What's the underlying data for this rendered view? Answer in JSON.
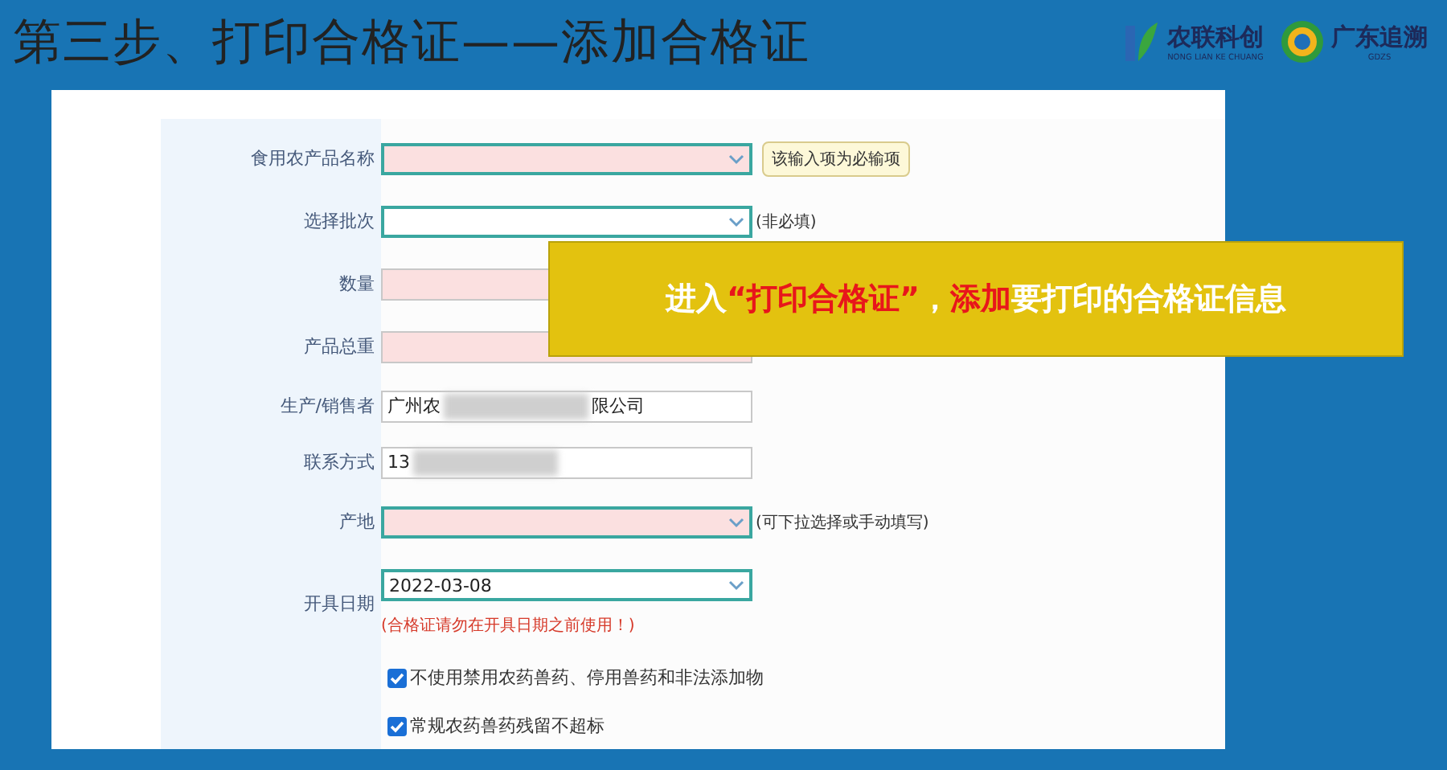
{
  "slide_title": "第三步、打印合格证——添加合格证",
  "logos": [
    {
      "name": "农联科创",
      "subtitle": "NONG LIAN KE CHUANG"
    },
    {
      "name": "广东追溯",
      "subtitle": "GDZS"
    }
  ],
  "form": {
    "rows": [
      {
        "label": "食用农产品名称",
        "kind": "select",
        "invalid": true,
        "tooltip": "该输入项为必输项"
      },
      {
        "label": "选择批次",
        "kind": "select",
        "invalid": false,
        "hint": "(非必填)"
      },
      {
        "label": "数量",
        "kind": "text",
        "invalid": true
      },
      {
        "label": "产品总重",
        "kind": "text",
        "invalid": true
      },
      {
        "label": "生产/销售者",
        "kind": "text",
        "invalid": false,
        "value": "广州农",
        "value_end": "限公司",
        "blurred": true
      },
      {
        "label": "联系方式",
        "kind": "text",
        "invalid": false,
        "value": "13",
        "blurred": true
      },
      {
        "label": "产地",
        "kind": "select",
        "invalid": true,
        "hint": "(可下拉选择或手动填写)"
      },
      {
        "label": "开具日期",
        "kind": "date",
        "invalid": false,
        "value": "2022-03-08",
        "note": "(合格证请勿在开具日期之前使用！)"
      }
    ],
    "checkboxes": [
      {
        "label": "不使用禁用农药兽药、停用兽药和非法添加物",
        "checked": true
      },
      {
        "label": "常规农药兽药残留不超标",
        "checked": true
      }
    ]
  },
  "callout": {
    "text": "进入**“打印合格证”**，**添加**要打印的合格证信息"
  }
}
